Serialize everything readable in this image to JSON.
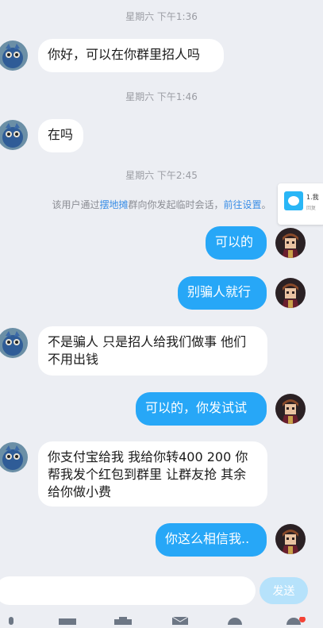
{
  "timestamps": [
    "星期六 下午1:36",
    "星期六 下午1:46",
    "星期六 下午2:45"
  ],
  "system_notice": {
    "prefix": "该用户通过",
    "group_link": "摆地摊",
    "middle": "群向你发起临时会话，",
    "settings_link": "前往设置",
    "suffix": "。"
  },
  "side_card": {
    "text1": "1.我",
    "text2": "回复"
  },
  "messages": [
    {
      "from": "other",
      "text": "你好，可以在你群里招人吗"
    },
    {
      "from": "other",
      "text": "在吗"
    },
    {
      "from": "me",
      "text": "可以的"
    },
    {
      "from": "me",
      "text": "别骗人就行"
    },
    {
      "from": "other",
      "text": "不是骗人 只是招人给我们做事  他们不用出钱"
    },
    {
      "from": "me",
      "text": "可以的，你发试试"
    },
    {
      "from": "other",
      "text": "你支付宝给我 我给你转400  200 你帮我发个红包到群里 让群友抢 其余给你做小费"
    },
    {
      "from": "me",
      "text": "你这么相信我.."
    }
  ],
  "input": {
    "value": "",
    "placeholder": ""
  },
  "send_label": "发送",
  "colors": {
    "outgoing_bubble": "#27a7f7",
    "incoming_bubble": "#ffffff",
    "background": "#eceef3",
    "send_disabled": "#b6e2fb"
  },
  "toolbar_icons": [
    "voice-icon",
    "image-icon",
    "camera-icon",
    "red-packet-icon",
    "emoji-icon",
    "more-icon"
  ]
}
